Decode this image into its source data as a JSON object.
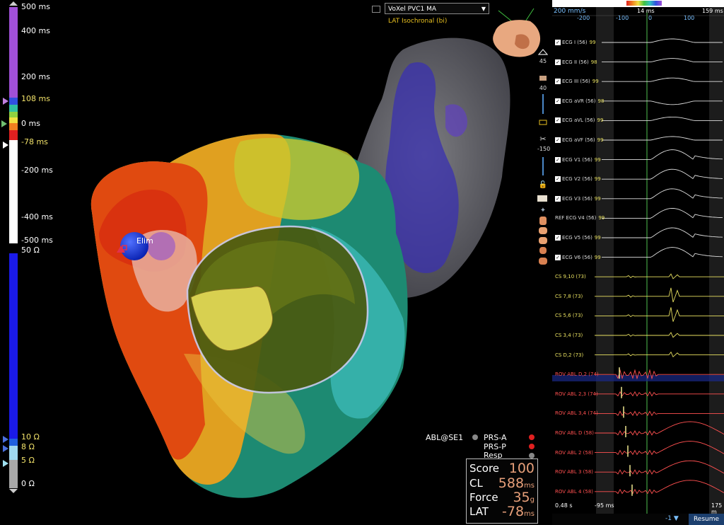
{
  "lat_scale": {
    "labels": [
      {
        "text": "500 ms",
        "color": "#ffffff"
      },
      {
        "text": "400 ms",
        "color": "#ffffff"
      },
      {
        "text": "200 ms",
        "color": "#ffffff"
      },
      {
        "text": "108 ms",
        "color": "#f3e36a"
      },
      {
        "text": "0 ms",
        "color": "#ffffff"
      },
      {
        "text": "-78 ms",
        "color": "#f3e36a"
      },
      {
        "text": "-200 ms",
        "color": "#ffffff"
      },
      {
        "text": "-400 ms",
        "color": "#ffffff"
      },
      {
        "text": "-500 ms",
        "color": "#ffffff"
      }
    ]
  },
  "ohm_scale": {
    "labels": [
      {
        "text": "50 Ω",
        "color": "#ffffff"
      },
      {
        "text": "10 Ω",
        "color": "#f3e36a"
      },
      {
        "text": "8 Ω",
        "color": "#f3e36a"
      },
      {
        "text": "5 Ω",
        "color": "#f3e36a"
      },
      {
        "text": "0 Ω",
        "color": "#ffffff"
      }
    ]
  },
  "map": {
    "selector_value": "VoXel PVC1 MA",
    "subtitle": "LAT Isochronal (bi)",
    "catheter_label": "Elim"
  },
  "tools": {
    "tilt": "45",
    "brightness": "40",
    "clip": "-150"
  },
  "status": {
    "catheter": "ABL@SE1",
    "items": [
      {
        "label": "PRS-A",
        "color": "#e02020"
      },
      {
        "label": "PRS-P",
        "color": "#e02020"
      },
      {
        "label": "Resp",
        "color": "#888888"
      }
    ]
  },
  "info": {
    "score_label": "Score",
    "score_value": "100",
    "cl_label": "CL",
    "cl_value": "588",
    "cl_unit": "ms",
    "force_label": "Force",
    "force_value": "35",
    "force_unit": "g",
    "lat_label": "LAT",
    "lat_value": "-78",
    "lat_unit": "ms"
  },
  "egm": {
    "sweep": "200 mm/s",
    "window_ms": "14 ms",
    "right_ms": "159 ms",
    "ticks": [
      "-200",
      "-100",
      "0",
      "100"
    ],
    "left_time": "0.48 s",
    "cursor_ms": "-95 ms",
    "right_time": "175 m",
    "bottom_value": "-1",
    "resume": "Resume",
    "channels": [
      {
        "label": "ECG I (56)",
        "value": "99",
        "color": "#dddddd",
        "cb": true
      },
      {
        "label": "ECG II (56)",
        "value": "98",
        "color": "#dddddd",
        "cb": true
      },
      {
        "label": "ECG III (56)",
        "value": "99",
        "color": "#dddddd",
        "cb": true
      },
      {
        "label": "ECG aVR (56)",
        "value": "98",
        "color": "#dddddd",
        "cb": true
      },
      {
        "label": "ECG aVL (56)",
        "value": "99",
        "color": "#dddddd",
        "cb": true
      },
      {
        "label": "ECG aVF (56)",
        "value": "99",
        "color": "#dddddd",
        "cb": true
      },
      {
        "label": "ECG V1 (56)",
        "value": "99",
        "color": "#dddddd",
        "cb": true
      },
      {
        "label": "ECG V2 (56)",
        "value": "99",
        "color": "#dddddd",
        "cb": true
      },
      {
        "label": "ECG V3 (56)",
        "value": "99",
        "color": "#dddddd",
        "cb": true
      },
      {
        "label": "REF ECG V4 (56)",
        "value": "99",
        "color": "#dddddd",
        "cb": false
      },
      {
        "label": "ECG V5 (56)",
        "value": "99",
        "color": "#dddddd",
        "cb": true
      },
      {
        "label": "ECG V6 (56)",
        "value": "99",
        "color": "#dddddd",
        "cb": true
      },
      {
        "label": "CS 9,10 (73)",
        "value": "",
        "color": "#e8e060",
        "cb": false
      },
      {
        "label": "CS 7,8 (73)",
        "value": "",
        "color": "#e8e060",
        "cb": false
      },
      {
        "label": "CS 5,6 (73)",
        "value": "",
        "color": "#e8e060",
        "cb": false
      },
      {
        "label": "CS 3,4 (73)",
        "value": "",
        "color": "#e8e060",
        "cb": false
      },
      {
        "label": "CS D,2 (73)",
        "value": "",
        "color": "#e8e060",
        "cb": false
      },
      {
        "label": "ROV ABL D,2 (74)",
        "value": "",
        "color": "#ff5050",
        "cb": false
      },
      {
        "label": "ROV ABL 2,3 (74)",
        "value": "",
        "color": "#ff5050",
        "cb": false
      },
      {
        "label": "ROV ABL 3,4 (74)",
        "value": "",
        "color": "#ff5050",
        "cb": false
      },
      {
        "label": "ROV ABL D (58)",
        "value": "",
        "color": "#ff5050",
        "cb": false
      },
      {
        "label": "ROV ABL 2 (58)",
        "value": "",
        "color": "#ff5050",
        "cb": false
      },
      {
        "label": "ROV ABL 3 (58)",
        "value": "",
        "color": "#ff5050",
        "cb": false
      },
      {
        "label": "ROV ABL 4 (58)",
        "value": "",
        "color": "#ff5050",
        "cb": false
      }
    ]
  }
}
